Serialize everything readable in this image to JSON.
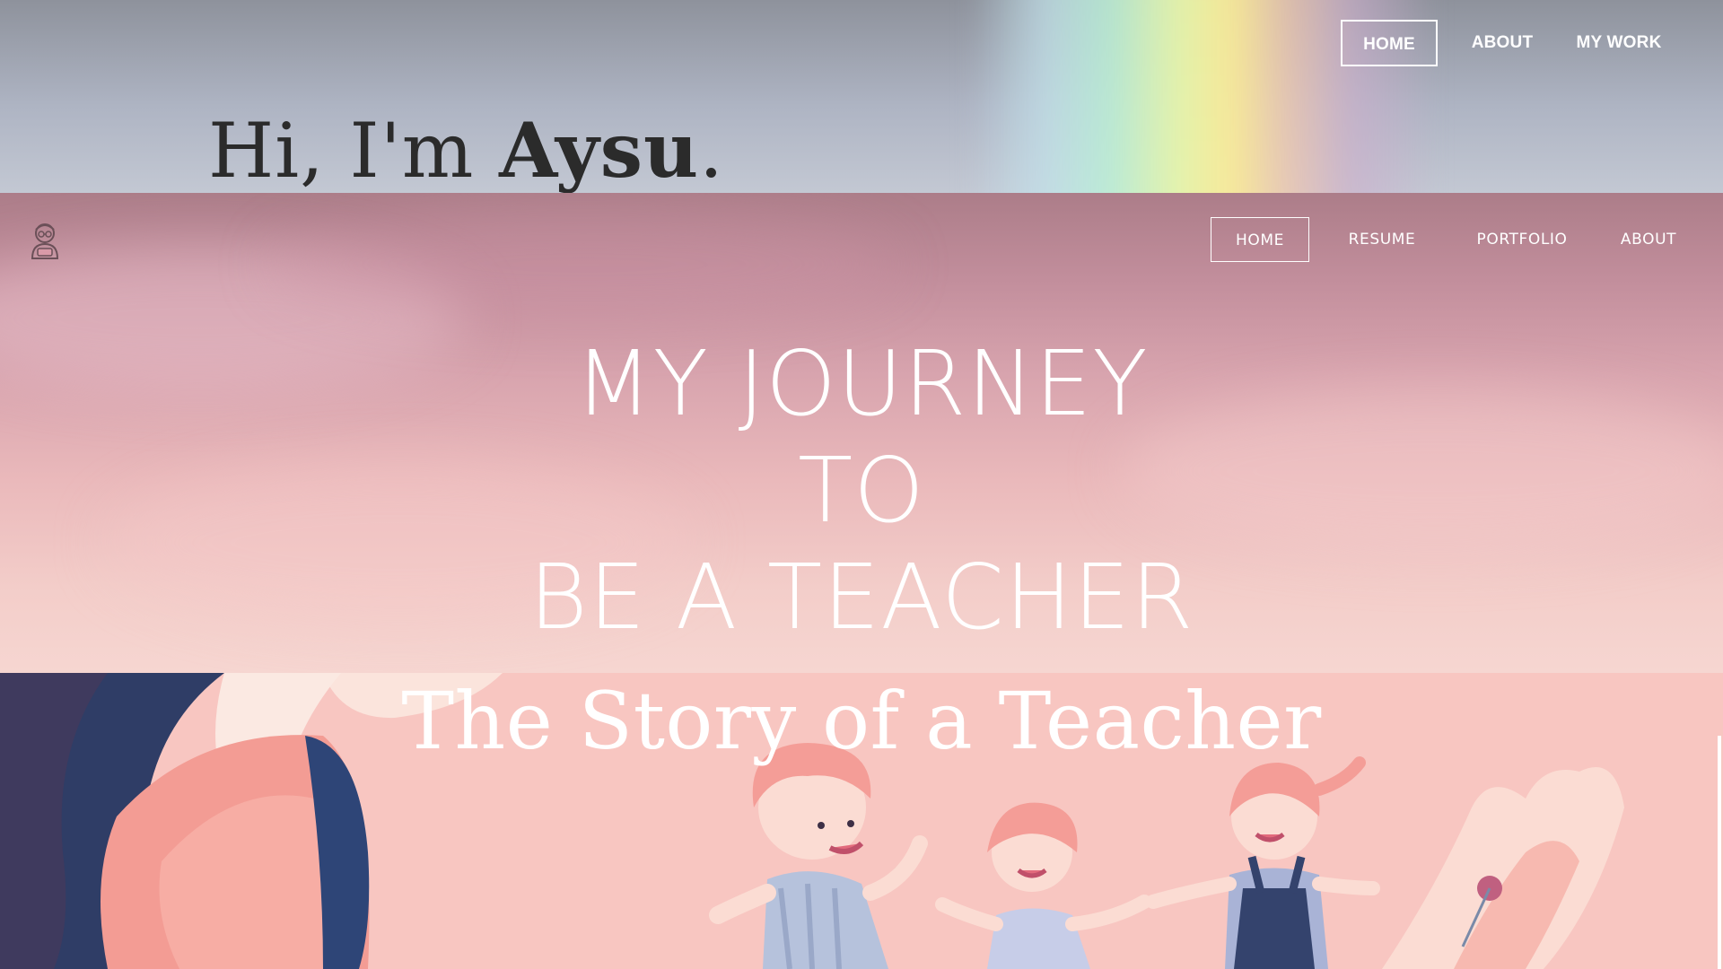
{
  "section_about": {
    "nav": [
      "HOME",
      "ABOUT",
      "MY WORK"
    ],
    "greeting_prefix": "Hi, I'm ",
    "greeting_name": "Aysu",
    "greeting_suffix": "."
  },
  "section_journey": {
    "nav": [
      "HOME",
      "RESUME",
      "PORTFOLIO",
      "ABOUT"
    ],
    "logo_icon": "teacher-avatar-icon",
    "headline_lines": [
      "MY JOURNEY",
      "TO",
      "BE A TEACHER"
    ]
  },
  "section_story": {
    "title": "The Story of a Teacher",
    "illustration": "children-holding-hands-illustration"
  },
  "colors": {
    "text_dark": "#2b2b2b",
    "text_light": "#ffffff",
    "story_background": "#f8c6c1",
    "navy_accent": "#2e3f6b"
  }
}
